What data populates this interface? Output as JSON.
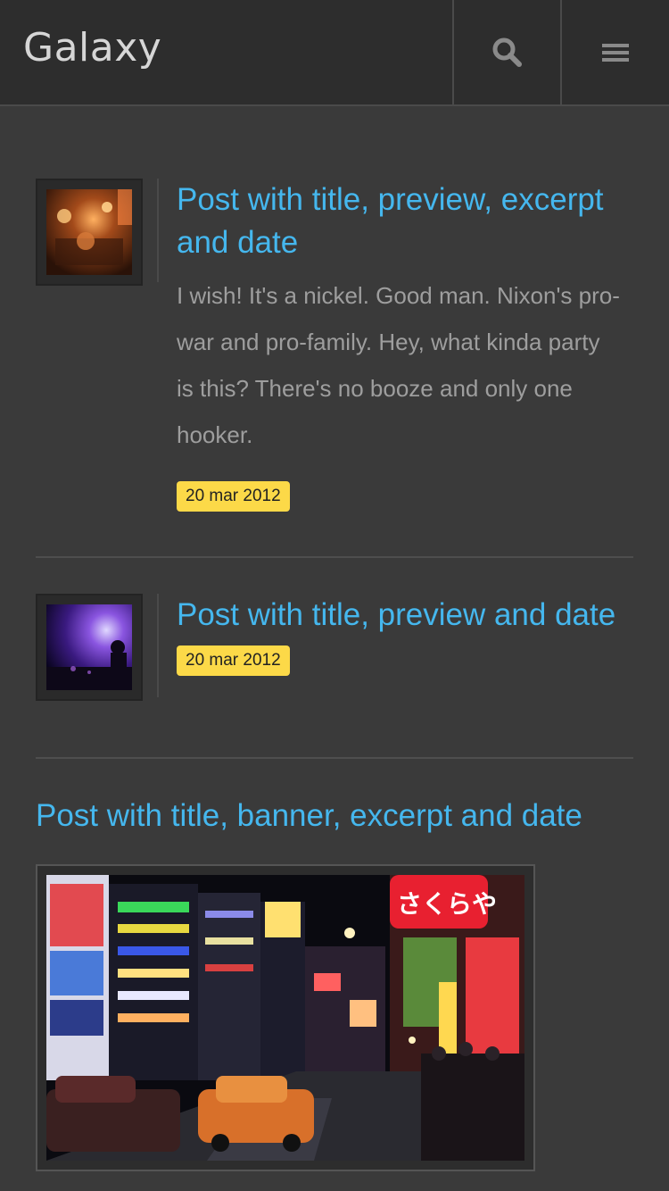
{
  "header": {
    "brand": "Galaxy",
    "search_icon": "search-icon",
    "menu_icon": "hamburger-menu-icon"
  },
  "posts": [
    {
      "title": "Post with title, preview, excerpt and date",
      "excerpt": "I wish! It's a nickel. Good man. Nixon's pro-war and pro-family. Hey, what kinda party is this? There's no booze and only one hooker.",
      "date": "20 mar 2012"
    },
    {
      "title": "Post with title, preview and date",
      "date": "20 mar 2012"
    },
    {
      "title": "Post with title, banner, excerpt and date"
    }
  ],
  "colors": {
    "accent": "#45b7ee",
    "date_badge": "#fcd948",
    "background": "#3a3a3a",
    "header": "#2d2d2d"
  }
}
